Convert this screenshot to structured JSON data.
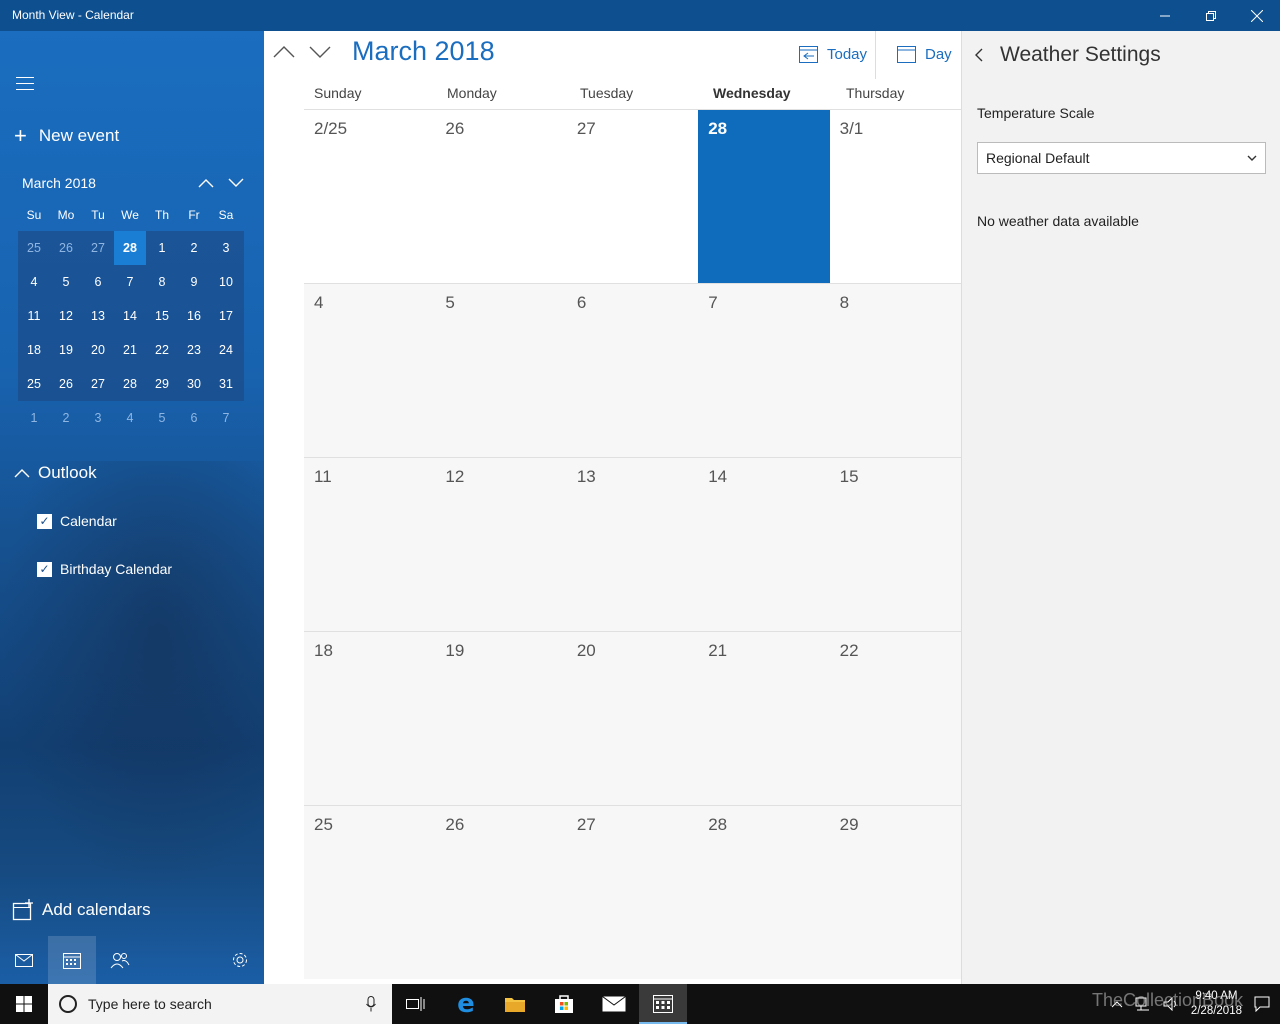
{
  "window": {
    "title": "Month View - Calendar"
  },
  "sidebar": {
    "new_event_label": "New event",
    "mini_calendar": {
      "title": "March 2018",
      "weekdays": [
        "Su",
        "Mo",
        "Tu",
        "We",
        "Th",
        "Fr",
        "Sa"
      ],
      "rows": [
        [
          "25",
          "26",
          "27",
          "28",
          "1",
          "2",
          "3"
        ],
        [
          "4",
          "5",
          "6",
          "7",
          "8",
          "9",
          "10"
        ],
        [
          "11",
          "12",
          "13",
          "14",
          "15",
          "16",
          "17"
        ],
        [
          "18",
          "19",
          "20",
          "21",
          "22",
          "23",
          "24"
        ],
        [
          "25",
          "26",
          "27",
          "28",
          "29",
          "30",
          "31"
        ],
        [
          "1",
          "2",
          "3",
          "4",
          "5",
          "6",
          "7"
        ]
      ]
    },
    "account_label": "Outlook",
    "calendars": [
      {
        "label": "Calendar",
        "checked": true
      },
      {
        "label": "Birthday Calendar",
        "checked": true
      }
    ],
    "add_calendars_label": "Add calendars"
  },
  "main": {
    "month_title": "March 2018",
    "today_label": "Today",
    "day_label": "Day",
    "weekdays": [
      "Sunday",
      "Monday",
      "Tuesday",
      "Wednesday",
      "Thursday"
    ],
    "weeks": [
      [
        "2/25",
        "26",
        "27",
        "28",
        "3/1"
      ],
      [
        "4",
        "5",
        "6",
        "7",
        "8"
      ],
      [
        "11",
        "12",
        "13",
        "14",
        "15"
      ],
      [
        "18",
        "19",
        "20",
        "21",
        "22"
      ],
      [
        "25",
        "26",
        "27",
        "28",
        "29"
      ]
    ]
  },
  "panel": {
    "title": "Weather Settings",
    "scale_label": "Temperature Scale",
    "scale_value": "Regional Default",
    "message": "No weather data available"
  },
  "taskbar": {
    "search_placeholder": "Type here to search",
    "time": "9:40 AM",
    "date": "2/28/2018"
  },
  "watermark": "TheCollectionBook",
  "colors": {
    "accent": "#0f6cbd",
    "titlebar": "#0e4f8f",
    "taskbar": "#101010"
  }
}
